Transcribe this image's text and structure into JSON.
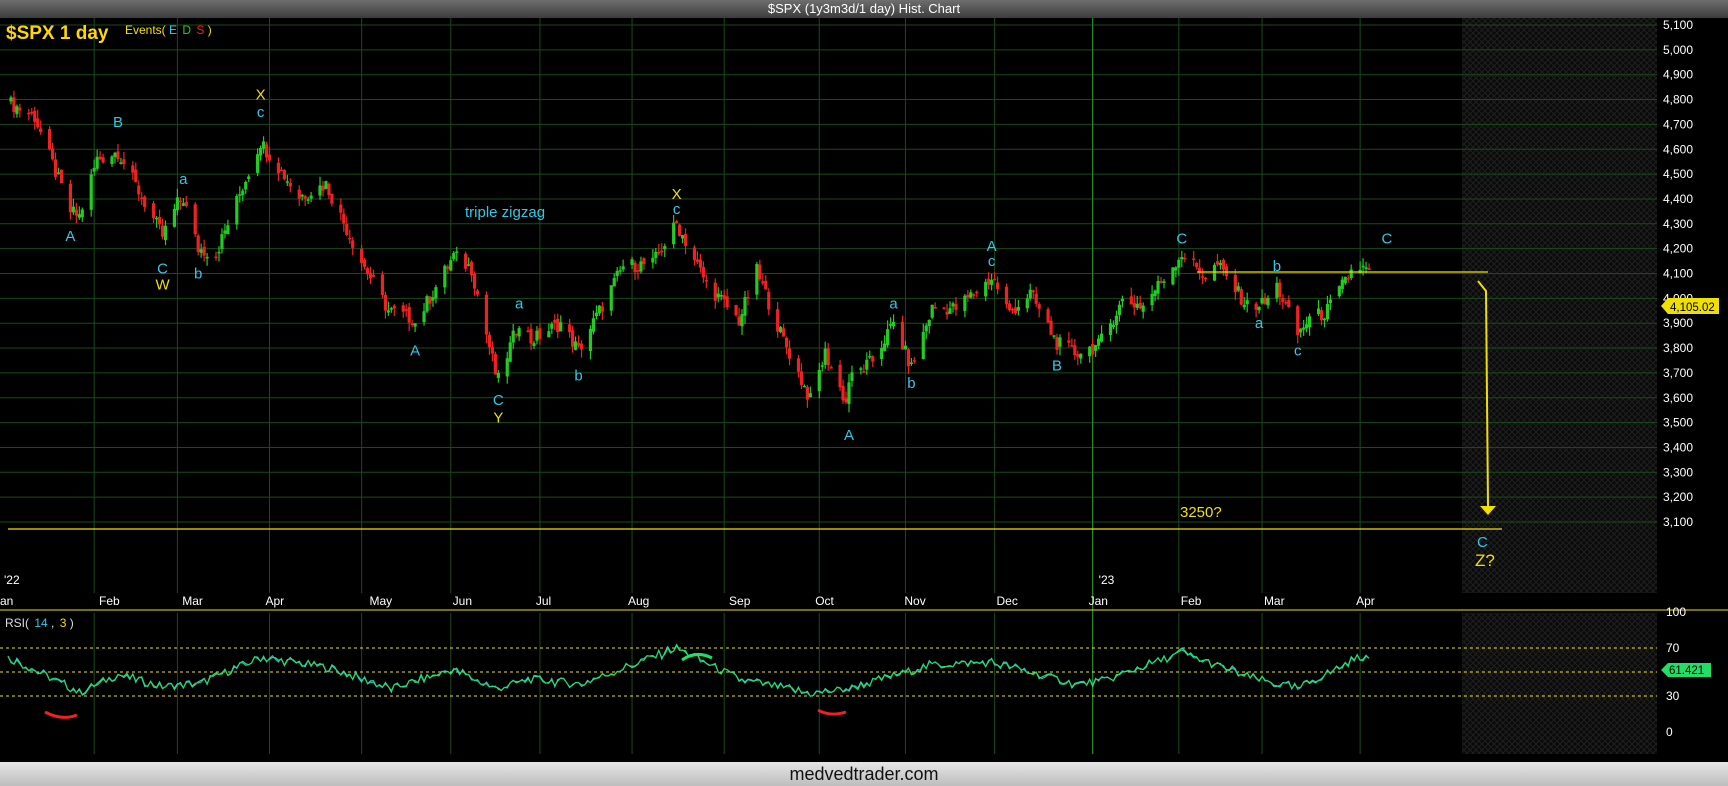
{
  "window": {
    "title": "$SPX (1y3m3d/1 day) Hist. Chart",
    "footer": "medvedtrader.com"
  },
  "colors": {
    "background": "#000000",
    "grid": "#1a4a1a",
    "up": "#22cc22",
    "down": "#ee2222",
    "wave_label": "#33c8e8",
    "yellow": "#f0e000",
    "rsi_line": "#22dd66",
    "rsi_signal": "#33c8e8"
  },
  "chart_header": {
    "symbol": "$SPX 1 day",
    "events_label": "Events(",
    "events_e": "E",
    "events_d": "D",
    "events_s": "S",
    "events_close": ")"
  },
  "chart_data": [
    {
      "type": "candlestick",
      "ylim": [
        3050,
        5130
      ],
      "y_ticks": [
        "5,100",
        "5,000",
        "4,900",
        "4,800",
        "4,700",
        "4,600",
        "4,500",
        "4,400",
        "4,300",
        "4,200",
        "4,100",
        "4,000",
        "3,900",
        "3,800",
        "3,700",
        "3,600",
        "3,500",
        "3,400",
        "3,300",
        "3,200",
        "3,100"
      ],
      "x_tick_labels": [
        "an",
        "Feb",
        "Mar",
        "Apr",
        "May",
        "Jun",
        "Jul",
        "Aug",
        "Sep",
        "Oct",
        "Nov",
        "Dec",
        "Jan",
        "Feb",
        "Mar",
        "Apr"
      ],
      "year_labels": [
        "'22",
        "'23"
      ],
      "last_price_label": "4,105.02",
      "price_path": [
        {
          "date": "2022-01-03",
          "close": 4790
        },
        {
          "date": "2022-01-12",
          "close": 4730
        },
        {
          "date": "2022-01-24",
          "close": 4350
        },
        {
          "date": "2022-01-27",
          "close": 4330
        },
        {
          "date": "2022-02-02",
          "close": 4560
        },
        {
          "date": "2022-02-09",
          "close": 4590
        },
        {
          "date": "2022-02-24",
          "close": 4250
        },
        {
          "date": "2022-03-01",
          "close": 4380
        },
        {
          "date": "2022-03-03",
          "close": 4400
        },
        {
          "date": "2022-03-08",
          "close": 4200
        },
        {
          "date": "2022-03-14",
          "close": 4180
        },
        {
          "date": "2022-03-29",
          "close": 4630
        },
        {
          "date": "2022-04-11",
          "close": 4410
        },
        {
          "date": "2022-04-20",
          "close": 4460
        },
        {
          "date": "2022-05-02",
          "close": 4150
        },
        {
          "date": "2022-05-11",
          "close": 3950
        },
        {
          "date": "2022-05-19",
          "close": 3920
        },
        {
          "date": "2022-05-20",
          "close": 3900
        },
        {
          "date": "2022-06-02",
          "close": 4170
        },
        {
          "date": "2022-06-08",
          "close": 4120
        },
        {
          "date": "2022-06-16",
          "close": 3700
        },
        {
          "date": "2022-06-17",
          "close": 3670
        },
        {
          "date": "2022-06-24",
          "close": 3910
        },
        {
          "date": "2022-06-28",
          "close": 3830
        },
        {
          "date": "2022-07-08",
          "close": 3900
        },
        {
          "date": "2022-07-14",
          "close": 3790
        },
        {
          "date": "2022-07-29",
          "close": 4130
        },
        {
          "date": "2022-08-08",
          "close": 4140
        },
        {
          "date": "2022-08-16",
          "close": 4300
        },
        {
          "date": "2022-08-19",
          "close": 4230
        },
        {
          "date": "2022-08-26",
          "close": 4060
        },
        {
          "date": "2022-09-06",
          "close": 3910
        },
        {
          "date": "2022-09-12",
          "close": 4110
        },
        {
          "date": "2022-09-20",
          "close": 3860
        },
        {
          "date": "2022-09-30",
          "close": 3590
        },
        {
          "date": "2022-10-05",
          "close": 3780
        },
        {
          "date": "2022-10-12",
          "close": 3580
        },
        {
          "date": "2022-10-13",
          "close": 3670
        },
        {
          "date": "2022-10-21",
          "close": 3750
        },
        {
          "date": "2022-10-28",
          "close": 3900
        },
        {
          "date": "2022-11-03",
          "close": 3720
        },
        {
          "date": "2022-11-10",
          "close": 3960
        },
        {
          "date": "2022-11-18",
          "close": 3960
        },
        {
          "date": "2022-11-30",
          "close": 4080
        },
        {
          "date": "2022-12-01",
          "close": 4070
        },
        {
          "date": "2022-12-06",
          "close": 3940
        },
        {
          "date": "2022-12-13",
          "close": 4020
        },
        {
          "date": "2022-12-22",
          "close": 3820
        },
        {
          "date": "2022-12-28",
          "close": 3780
        },
        {
          "date": "2023-01-05",
          "close": 3810
        },
        {
          "date": "2023-01-13",
          "close": 3990
        },
        {
          "date": "2023-01-20",
          "close": 3970
        },
        {
          "date": "2023-02-02",
          "close": 4180
        },
        {
          "date": "2023-02-10",
          "close": 4090
        },
        {
          "date": "2023-02-14",
          "close": 4135
        },
        {
          "date": "2023-02-24",
          "close": 3970
        },
        {
          "date": "2023-03-02",
          "close": 3980
        },
        {
          "date": "2023-03-06",
          "close": 4050
        },
        {
          "date": "2023-03-13",
          "close": 3855
        },
        {
          "date": "2023-03-17",
          "close": 3920
        },
        {
          "date": "2023-03-22",
          "close": 3940
        },
        {
          "date": "2023-03-24",
          "close": 3970
        },
        {
          "date": "2023-03-31",
          "close": 4110
        },
        {
          "date": "2023-04-03",
          "close": 4125
        },
        {
          "date": "2023-04-06",
          "close": 4105.02
        }
      ]
    },
    {
      "type": "line",
      "indicator_label": "RSI(",
      "period_a": "14",
      "period_b": "3",
      "indicator_close": ")",
      "ylim": [
        0,
        100
      ],
      "y_ticks": [
        "100",
        "70",
        "50",
        "30",
        "0"
      ],
      "reference_levels": [
        30,
        50,
        70
      ],
      "last_value_label": "61.421",
      "series": [
        {
          "x": "2022-01-03",
          "value": 62
        },
        {
          "x": "2022-01-20",
          "value": 42
        },
        {
          "x": "2022-01-27",
          "value": 33
        },
        {
          "x": "2022-02-09",
          "value": 48
        },
        {
          "x": "2022-02-24",
          "value": 38
        },
        {
          "x": "2022-03-08",
          "value": 40
        },
        {
          "x": "2022-03-29",
          "value": 62
        },
        {
          "x": "2022-04-20",
          "value": 54
        },
        {
          "x": "2022-05-12",
          "value": 36
        },
        {
          "x": "2022-06-02",
          "value": 52
        },
        {
          "x": "2022-06-16",
          "value": 36
        },
        {
          "x": "2022-06-28",
          "value": 44
        },
        {
          "x": "2022-07-15",
          "value": 40
        },
        {
          "x": "2022-08-16",
          "value": 70
        },
        {
          "x": "2022-09-06",
          "value": 44
        },
        {
          "x": "2022-09-30",
          "value": 32
        },
        {
          "x": "2022-10-13",
          "value": 36
        },
        {
          "x": "2022-11-10",
          "value": 56
        },
        {
          "x": "2022-11-30",
          "value": 58
        },
        {
          "x": "2022-12-28",
          "value": 40
        },
        {
          "x": "2023-01-06",
          "value": 42
        },
        {
          "x": "2023-02-02",
          "value": 66
        },
        {
          "x": "2023-02-24",
          "value": 46
        },
        {
          "x": "2023-03-13",
          "value": 36
        },
        {
          "x": "2023-03-24",
          "value": 50
        },
        {
          "x": "2023-04-03",
          "value": 63
        },
        {
          "x": "2023-04-06",
          "value": 61.421
        }
      ]
    }
  ],
  "annotations": {
    "wave_labels": [
      {
        "text": "A",
        "date": "2022-01-24",
        "price": 4230,
        "color": "cyan"
      },
      {
        "text": "B",
        "date": "2022-02-09",
        "price": 4690,
        "color": "cyan"
      },
      {
        "text": "C",
        "date": "2022-02-24",
        "price": 4100,
        "color": "cyan"
      },
      {
        "text": "W",
        "date": "2022-02-24",
        "price": 4035,
        "color": "yellow"
      },
      {
        "text": "a",
        "date": "2022-03-03",
        "price": 4460,
        "color": "cyan"
      },
      {
        "text": "b",
        "date": "2022-03-08",
        "price": 4080,
        "color": "cyan"
      },
      {
        "text": "X",
        "date": "2022-03-29",
        "price": 4800,
        "color": "yellow"
      },
      {
        "text": "c",
        "date": "2022-03-29",
        "price": 4730,
        "color": "cyan"
      },
      {
        "text": "A",
        "date": "2022-05-20",
        "price": 3770,
        "color": "cyan"
      },
      {
        "text": "C",
        "date": "2022-06-17",
        "price": 3570,
        "color": "cyan"
      },
      {
        "text": "Y",
        "date": "2022-06-17",
        "price": 3500,
        "color": "yellow"
      },
      {
        "text": "a",
        "date": "2022-06-24",
        "price": 3960,
        "color": "cyan"
      },
      {
        "text": "b",
        "date": "2022-07-14",
        "price": 3670,
        "color": "cyan"
      },
      {
        "text": "X",
        "date": "2022-08-16",
        "price": 4400,
        "color": "yellow"
      },
      {
        "text": "c",
        "date": "2022-08-16",
        "price": 4340,
        "color": "cyan"
      },
      {
        "text": "A",
        "date": "2022-10-13",
        "price": 3430,
        "color": "cyan"
      },
      {
        "text": "a",
        "date": "2022-10-28",
        "price": 3960,
        "color": "cyan"
      },
      {
        "text": "b",
        "date": "2022-11-03",
        "price": 3640,
        "color": "cyan"
      },
      {
        "text": "A",
        "date": "2022-11-30",
        "price": 4190,
        "color": "cyan"
      },
      {
        "text": "c",
        "date": "2022-11-30",
        "price": 4130,
        "color": "cyan"
      },
      {
        "text": "B",
        "date": "2022-12-22",
        "price": 3710,
        "color": "cyan"
      },
      {
        "text": "C",
        "date": "2023-02-02",
        "price": 4220,
        "color": "cyan"
      },
      {
        "text": "b",
        "date": "2023-03-06",
        "price": 4110,
        "color": "cyan"
      },
      {
        "text": "a",
        "date": "2023-02-28",
        "price": 3880,
        "color": "cyan"
      },
      {
        "text": "c",
        "date": "2023-03-13",
        "price": 3770,
        "color": "cyan"
      },
      {
        "text": "C",
        "date": "2023-04-12",
        "price": 4220,
        "color": "cyan"
      }
    ],
    "triple_zigzag": "triple zigzag",
    "target_label": "3250?",
    "target_c": "C",
    "target_z": "Z?"
  }
}
